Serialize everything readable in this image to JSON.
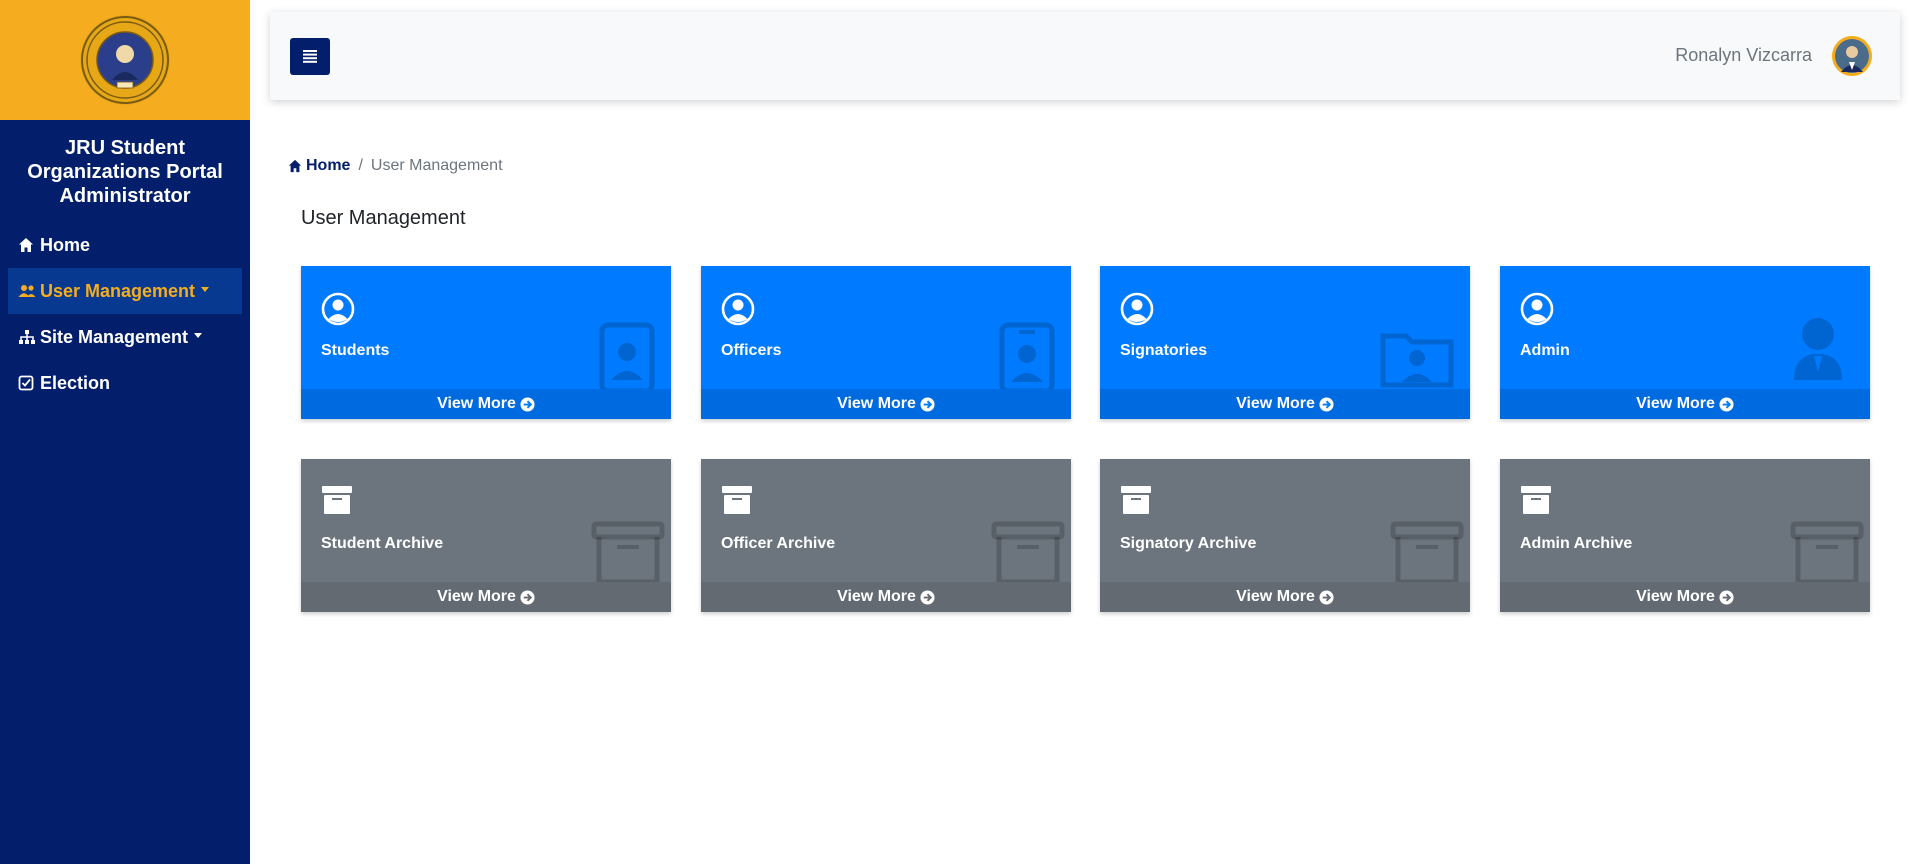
{
  "sidebar": {
    "title": "JRU Student Organizations Portal Administrator",
    "items": [
      {
        "label": "Home"
      },
      {
        "label": "User Management"
      },
      {
        "label": "Site Management"
      },
      {
        "label": "Election"
      }
    ]
  },
  "topbar": {
    "user_name": "Ronalyn Vizcarra"
  },
  "breadcrumb": {
    "home": "Home",
    "separator": "/",
    "current": "User Management"
  },
  "page_title": "User Management",
  "cards": [
    {
      "label": "Students",
      "footer": "View More"
    },
    {
      "label": "Officers",
      "footer": "View More"
    },
    {
      "label": "Signatories",
      "footer": "View More"
    },
    {
      "label": "Admin",
      "footer": "View More"
    },
    {
      "label": "Student Archive",
      "footer": "View More"
    },
    {
      "label": "Officer Archive",
      "footer": "View More"
    },
    {
      "label": "Signatory Archive",
      "footer": "View More"
    },
    {
      "label": "Admin Archive",
      "footer": "View More"
    }
  ],
  "colors": {
    "sidebar": "#031f6b",
    "logo_bg": "#f5ad1f",
    "accent": "#f5ad1f",
    "card_blue": "#007bff",
    "card_gray": "#6c757d"
  },
  "icons": {
    "menu": "hamburger-icon",
    "home": "house-icon",
    "users": "users-icon",
    "site": "sitemap-icon",
    "election": "check-square-icon",
    "card_primary": "user-circle-icon",
    "card_archive": "archive-box-icon",
    "footer_arrow": "arrow-circle-right-icon"
  }
}
